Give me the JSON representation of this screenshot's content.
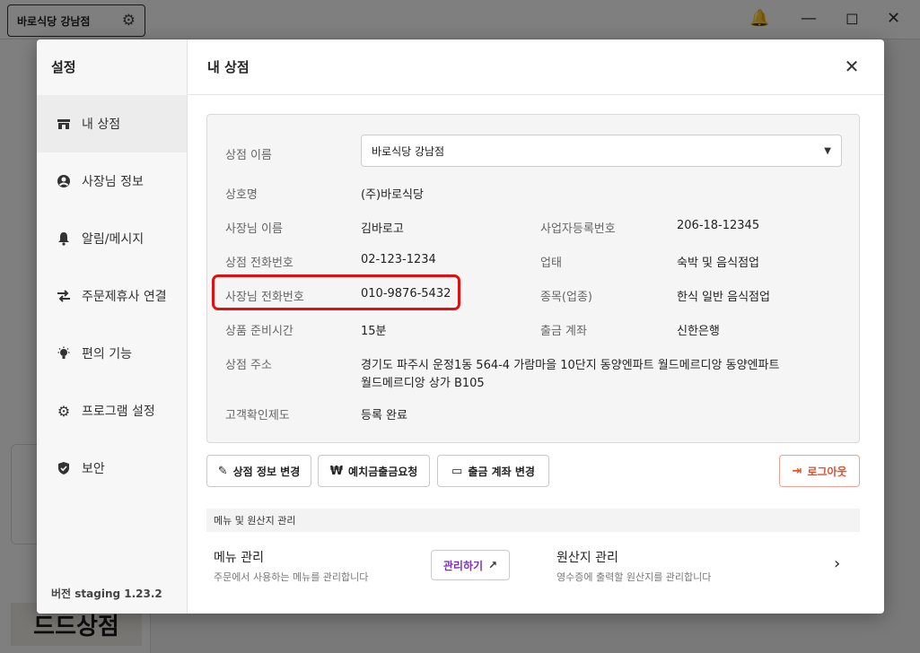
{
  "background": {
    "store_select": "바로식당 강남점",
    "logo_text": "드드상점",
    "window_controls": [
      "bell-icon",
      "minimize-icon",
      "maximize-icon",
      "close-icon"
    ]
  },
  "modal": {
    "sidebar_title": "설정",
    "nav_items": [
      {
        "label": "내 상점",
        "icon": "store-icon"
      },
      {
        "label": "사장님 정보",
        "icon": "user-icon"
      },
      {
        "label": "알림/메시지",
        "icon": "bell-icon"
      },
      {
        "label": "주문제휴사 연결",
        "icon": "swap-icon"
      },
      {
        "label": "편의 기능",
        "icon": "bulb-icon"
      },
      {
        "label": "프로그램 설정",
        "icon": "gear-icon"
      },
      {
        "label": "보안",
        "icon": "shield-icon"
      }
    ],
    "version": "버전 staging 1.23.2",
    "header_title": "내 상점",
    "info": {
      "store_name_label": "상점 이름",
      "store_name_value": "바로식당 강남점",
      "business_name_label": "상호명",
      "business_name_value": "(주)바로식당",
      "owner_name_label": "사장님 이름",
      "owner_name_value": "김바로고",
      "biz_reg_label": "사업자등록번호",
      "biz_reg_value": "206-18-12345",
      "store_phone_label": "상점 전화번호",
      "store_phone_value": "02-123-1234",
      "biz_type_label": "업태",
      "biz_type_value": "숙박 및 음식점업",
      "owner_phone_label": "사장님 전화번호",
      "owner_phone_value": "010-9876-5432",
      "category_label": "종목(업종)",
      "category_value": "한식 일반 음식점업",
      "prep_time_label": "상품 준비시간",
      "prep_time_value": "15분",
      "account_label": "출금 계좌",
      "account_value": "신한은행",
      "address_label": "상점 주소",
      "address_line1": "경기도 파주시 운정1동 564-4 가람마을 10단지 동양엔파트 월드메르디앙 동양엔파트",
      "address_line2": "월드메르디앙 상가 B105",
      "verify_label": "고객확인제도",
      "verify_value": "등록 완료"
    },
    "buttons": {
      "edit_store": "상점 정보 변경",
      "deposit_withdraw": "예치금출금요청",
      "change_account": "출금 계좌 변경",
      "logout": "로그아웃"
    },
    "section": {
      "title": "메뉴 및 원산지 관리",
      "menu_title": "메뉴 관리",
      "menu_desc": "주문에서 사용하는 메뉴를 관리합니다",
      "manage_button": "관리하기",
      "origin_title": "원산지 관리",
      "origin_desc": "영수증에 출력할 원산지를 관리합니다"
    },
    "colors": {
      "highlight": "#e01010",
      "logout": "#e04e2b",
      "manage_link": "#7a2fbf"
    }
  }
}
